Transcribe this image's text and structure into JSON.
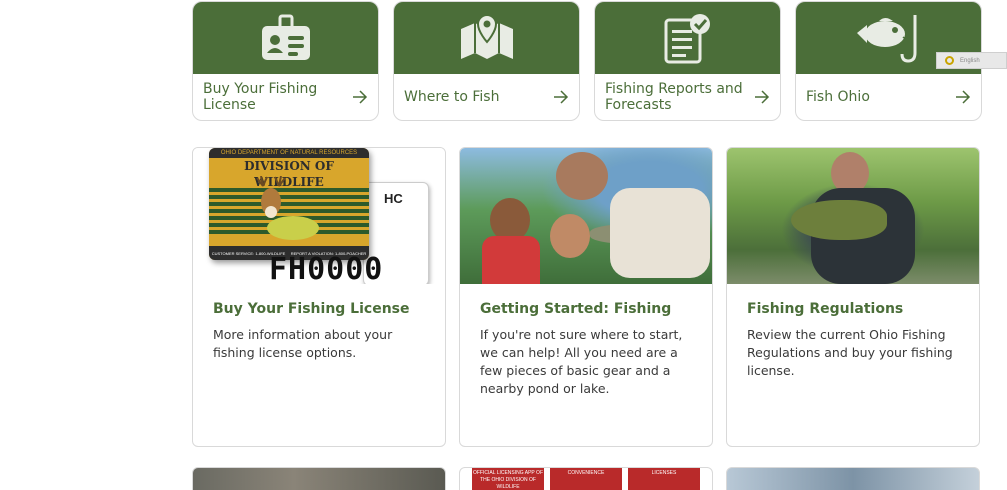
{
  "tiles": [
    {
      "label": "Buy Your Fishing License",
      "icon": "id-card-icon"
    },
    {
      "label": "Where to Fish",
      "icon": "map-pin-icon"
    },
    {
      "label": "Fishing Reports and Forecasts",
      "icon": "report-check-icon"
    },
    {
      "label": "Fish Ohio",
      "icon": "fish-hook-icon"
    }
  ],
  "language": {
    "label": "English"
  },
  "cards": [
    {
      "title": "Buy Your Fishing License",
      "text": "More information about your fishing license options.",
      "image": {
        "header_small": "OHIO DEPARTMENT OF NATURAL RESOURCES",
        "header_main": "DIVISION OF WILDLIFE",
        "footer_left": "CUSTOMER SERVICE: 1-800-WILDLIFE",
        "footer_right": "REPORT A VIOLATION: 1-800-POACHER",
        "back_code": "HC",
        "number": "FH0000"
      }
    },
    {
      "title": "Getting Started: Fishing",
      "text": "If you're not sure where to start, we can help! All you need are a few pieces of basic gear and a nearby pond or lake."
    },
    {
      "title": "Fishing Regulations",
      "text": "Review the current Ohio Fishing Regulations and buy your fishing license."
    }
  ],
  "bottom_cards": {
    "app_labels": [
      "OFFICIAL LICENSING APP OF THE OHIO DIVISION OF WILDLIFE",
      "CONVENIENCE",
      "LICENSES"
    ]
  },
  "colors": {
    "brand_green": "#4b6e39",
    "border": "#d9d9d9"
  }
}
